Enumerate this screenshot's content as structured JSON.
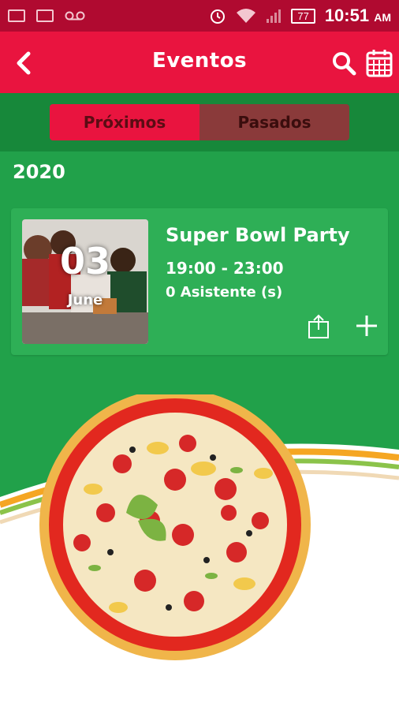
{
  "status_bar": {
    "time": "10:51",
    "ampm": "AM",
    "battery": "77"
  },
  "app_bar": {
    "title": "Eventos"
  },
  "tabs": [
    {
      "label": "Próximos",
      "active": true
    },
    {
      "label": "Pasados",
      "active": false
    }
  ],
  "year": "2020",
  "event": {
    "day": "03",
    "month": "June",
    "title": "Super Bowl Party",
    "time": "19:00 - 23:00",
    "attendees": "0 Asistente (s)"
  },
  "icons": {
    "back": "chevron-left-icon",
    "search": "search-icon",
    "calendar": "calendar-icon",
    "share": "share-icon",
    "add": "plus-icon"
  },
  "colors": {
    "status_bar": "#b00a30",
    "app_bar": "#e9143f",
    "green": "#21a14a",
    "green_dark": "#17883a",
    "tab_active": "#e9143f",
    "tab_inactive": "#8a3a3a"
  }
}
